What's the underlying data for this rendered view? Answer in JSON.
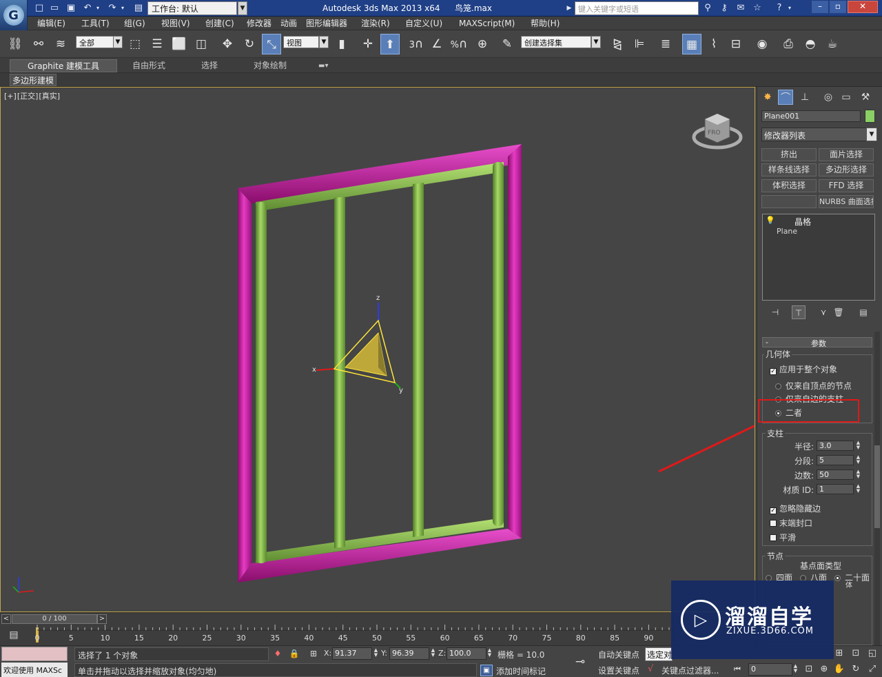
{
  "titlebar": {
    "workspace_value": "工作台: 默认",
    "app_title": "Autodesk 3ds Max  2013 x64",
    "file_name": "鸟笼.max",
    "search_placeholder": "键入关键字或短语",
    "quick_icons": [
      "new-file-icon",
      "open-folder-icon",
      "save-icon",
      "undo-icon",
      "redo-icon",
      "project-folder-icon"
    ],
    "bg_color": "#1f3f86"
  },
  "menubar": {
    "items": [
      "编辑(E)",
      "工具(T)",
      "组(G)",
      "视图(V)",
      "创建(C)",
      "修改器",
      "动画",
      "图形编辑器",
      "渲染(R)",
      "自定义(U)",
      "MAXScript(M)",
      "帮助(H)"
    ]
  },
  "toolbar": {
    "selection_filter": "全部",
    "ref_coord": "视图",
    "snap_3": "3",
    "snap_angle_symbol": "%",
    "named_selection_set": "创建选择集"
  },
  "ribbon": {
    "tabs": [
      "Graphite 建模工具",
      "自由形式",
      "选择",
      "对象绘制"
    ],
    "sub_label": "多边形建模"
  },
  "viewport": {
    "label_parts": [
      "[+]",
      "[正交]",
      "[真实]"
    ],
    "gizmo_axes": [
      "x",
      "y",
      "z"
    ],
    "viewcube_label": "FRO",
    "frame_color": "#c8169c",
    "bars_color": "#8dc651"
  },
  "command_panel": {
    "object_name": "Plane001",
    "object_color": "#8ad064",
    "modifier_list": "修改器列表",
    "modifier_buttons": [
      "挤出",
      "面片选择",
      "样条线选择",
      "多边形选择",
      "体积选择",
      "FFD 选择",
      "",
      "NURBS 曲面选择"
    ],
    "stack_items": [
      "晶格",
      "Plane"
    ],
    "rollout_title": "参数",
    "geometry": {
      "group_label": "几何体",
      "apply_whole": "应用于整个对象",
      "apply_whole_checked": true,
      "radio_options": [
        "仅来自顶点的节点",
        "仅来自边的支柱",
        "二者"
      ],
      "radio_selected": 2
    },
    "struts": {
      "group_label": "支柱",
      "radius_label": "半径:",
      "radius_value": "3.0",
      "segments_label": "分段:",
      "segments_value": "5",
      "sides_label": "边数:",
      "sides_value": "50",
      "matid_label": "材质 ID:",
      "matid_value": "1",
      "ignore_hidden": "忽略隐藏边",
      "ignore_hidden_checked": true,
      "end_caps": "末端封口",
      "end_caps_checked": false,
      "smooth": "平滑",
      "smooth_checked": false
    },
    "joints": {
      "group_label": "节点",
      "base_type_label": "基点面类型",
      "radio_options": [
        "四面",
        "八面",
        "二十面"
      ],
      "radio_extra": "体",
      "radio_selected": 2
    }
  },
  "time_slider": {
    "position_text": "0 / 100",
    "left_arrow": "<",
    "right_arrow": ">"
  },
  "trackbar": {
    "frame_labels": [
      "0",
      "5",
      "10",
      "15",
      "20",
      "25",
      "30",
      "35",
      "40",
      "45",
      "50",
      "55",
      "60",
      "65",
      "70",
      "75",
      "80",
      "85",
      "90"
    ]
  },
  "status": {
    "welcome": "欢迎使用 MAXSc",
    "selected": "选择了 1 个对象",
    "prompt": "单击并拖动以选择并缩放对象(均匀地)",
    "x_label": "X:",
    "x_value": "91.37",
    "y_label": "Y:",
    "y_value": "96.39",
    "z_label": "Z:",
    "z_value": "100.0",
    "grid": "栅格 = 10.0",
    "add_time_tag": "添加时间标记",
    "auto_key": "自动关键点",
    "set_key": "设置关键点",
    "selected_dd": "选定对",
    "key_filters": "关键点过滤器...",
    "frame_value": "0"
  },
  "watermark": {
    "title": "溜溜自学",
    "url": "ZIXUE.3D66.COM"
  },
  "annotation": {
    "highlight_color": "#e01919"
  }
}
